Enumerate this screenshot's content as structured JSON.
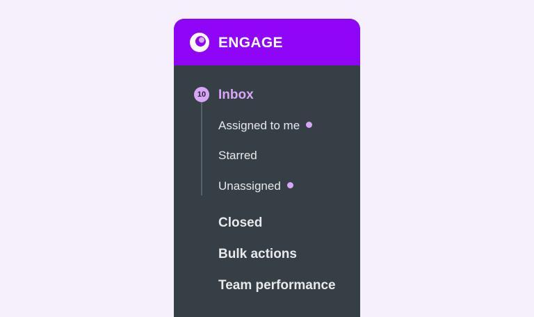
{
  "header": {
    "brand": "ENGAGE",
    "logo_icon": "engage-logo-icon",
    "bg_color": "#8e05f8"
  },
  "inbox": {
    "label": "Inbox",
    "count": "10",
    "subitems": [
      {
        "label": "Assigned to me",
        "has_dot": true
      },
      {
        "label": "Starred",
        "has_dot": false
      },
      {
        "label": "Unassigned",
        "has_dot": true
      }
    ]
  },
  "nav": [
    {
      "label": "Closed"
    },
    {
      "label": "Bulk actions"
    },
    {
      "label": "Team performance"
    }
  ],
  "colors": {
    "page_bg": "#f6f0fd",
    "panel_bg": "#373f46",
    "accent": "#d8a6f7",
    "text": "#e7e9eb"
  }
}
